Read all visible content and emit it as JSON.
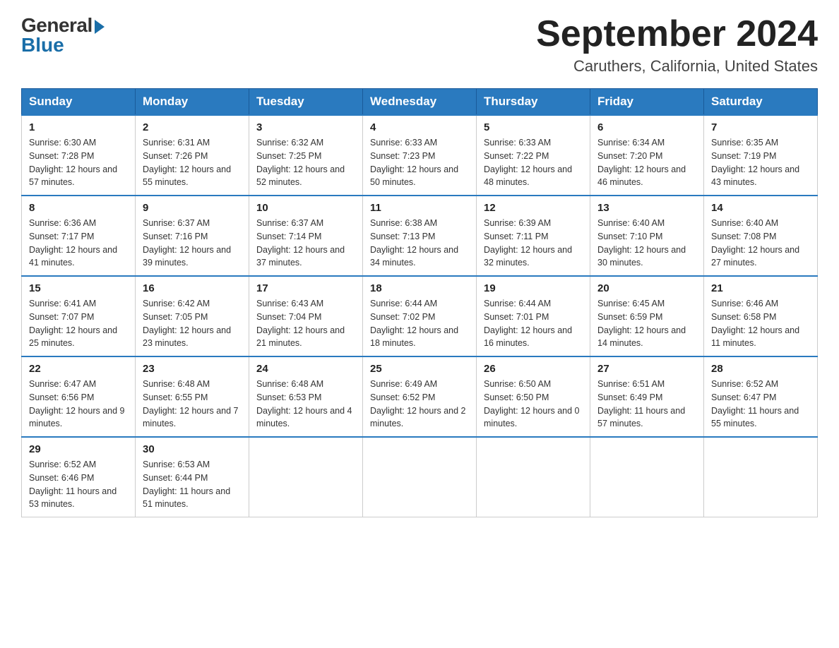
{
  "header": {
    "logo_general": "General",
    "logo_blue": "Blue",
    "month_title": "September 2024",
    "location": "Caruthers, California, United States"
  },
  "days_of_week": [
    "Sunday",
    "Monday",
    "Tuesday",
    "Wednesday",
    "Thursday",
    "Friday",
    "Saturday"
  ],
  "weeks": [
    [
      {
        "num": "1",
        "sunrise": "6:30 AM",
        "sunset": "7:28 PM",
        "daylight": "12 hours and 57 minutes."
      },
      {
        "num": "2",
        "sunrise": "6:31 AM",
        "sunset": "7:26 PM",
        "daylight": "12 hours and 55 minutes."
      },
      {
        "num": "3",
        "sunrise": "6:32 AM",
        "sunset": "7:25 PM",
        "daylight": "12 hours and 52 minutes."
      },
      {
        "num": "4",
        "sunrise": "6:33 AM",
        "sunset": "7:23 PM",
        "daylight": "12 hours and 50 minutes."
      },
      {
        "num": "5",
        "sunrise": "6:33 AM",
        "sunset": "7:22 PM",
        "daylight": "12 hours and 48 minutes."
      },
      {
        "num": "6",
        "sunrise": "6:34 AM",
        "sunset": "7:20 PM",
        "daylight": "12 hours and 46 minutes."
      },
      {
        "num": "7",
        "sunrise": "6:35 AM",
        "sunset": "7:19 PM",
        "daylight": "12 hours and 43 minutes."
      }
    ],
    [
      {
        "num": "8",
        "sunrise": "6:36 AM",
        "sunset": "7:17 PM",
        "daylight": "12 hours and 41 minutes."
      },
      {
        "num": "9",
        "sunrise": "6:37 AM",
        "sunset": "7:16 PM",
        "daylight": "12 hours and 39 minutes."
      },
      {
        "num": "10",
        "sunrise": "6:37 AM",
        "sunset": "7:14 PM",
        "daylight": "12 hours and 37 minutes."
      },
      {
        "num": "11",
        "sunrise": "6:38 AM",
        "sunset": "7:13 PM",
        "daylight": "12 hours and 34 minutes."
      },
      {
        "num": "12",
        "sunrise": "6:39 AM",
        "sunset": "7:11 PM",
        "daylight": "12 hours and 32 minutes."
      },
      {
        "num": "13",
        "sunrise": "6:40 AM",
        "sunset": "7:10 PM",
        "daylight": "12 hours and 30 minutes."
      },
      {
        "num": "14",
        "sunrise": "6:40 AM",
        "sunset": "7:08 PM",
        "daylight": "12 hours and 27 minutes."
      }
    ],
    [
      {
        "num": "15",
        "sunrise": "6:41 AM",
        "sunset": "7:07 PM",
        "daylight": "12 hours and 25 minutes."
      },
      {
        "num": "16",
        "sunrise": "6:42 AM",
        "sunset": "7:05 PM",
        "daylight": "12 hours and 23 minutes."
      },
      {
        "num": "17",
        "sunrise": "6:43 AM",
        "sunset": "7:04 PM",
        "daylight": "12 hours and 21 minutes."
      },
      {
        "num": "18",
        "sunrise": "6:44 AM",
        "sunset": "7:02 PM",
        "daylight": "12 hours and 18 minutes."
      },
      {
        "num": "19",
        "sunrise": "6:44 AM",
        "sunset": "7:01 PM",
        "daylight": "12 hours and 16 minutes."
      },
      {
        "num": "20",
        "sunrise": "6:45 AM",
        "sunset": "6:59 PM",
        "daylight": "12 hours and 14 minutes."
      },
      {
        "num": "21",
        "sunrise": "6:46 AM",
        "sunset": "6:58 PM",
        "daylight": "12 hours and 11 minutes."
      }
    ],
    [
      {
        "num": "22",
        "sunrise": "6:47 AM",
        "sunset": "6:56 PM",
        "daylight": "12 hours and 9 minutes."
      },
      {
        "num": "23",
        "sunrise": "6:48 AM",
        "sunset": "6:55 PM",
        "daylight": "12 hours and 7 minutes."
      },
      {
        "num": "24",
        "sunrise": "6:48 AM",
        "sunset": "6:53 PM",
        "daylight": "12 hours and 4 minutes."
      },
      {
        "num": "25",
        "sunrise": "6:49 AM",
        "sunset": "6:52 PM",
        "daylight": "12 hours and 2 minutes."
      },
      {
        "num": "26",
        "sunrise": "6:50 AM",
        "sunset": "6:50 PM",
        "daylight": "12 hours and 0 minutes."
      },
      {
        "num": "27",
        "sunrise": "6:51 AM",
        "sunset": "6:49 PM",
        "daylight": "11 hours and 57 minutes."
      },
      {
        "num": "28",
        "sunrise": "6:52 AM",
        "sunset": "6:47 PM",
        "daylight": "11 hours and 55 minutes."
      }
    ],
    [
      {
        "num": "29",
        "sunrise": "6:52 AM",
        "sunset": "6:46 PM",
        "daylight": "11 hours and 53 minutes."
      },
      {
        "num": "30",
        "sunrise": "6:53 AM",
        "sunset": "6:44 PM",
        "daylight": "11 hours and 51 minutes."
      },
      null,
      null,
      null,
      null,
      null
    ]
  ]
}
